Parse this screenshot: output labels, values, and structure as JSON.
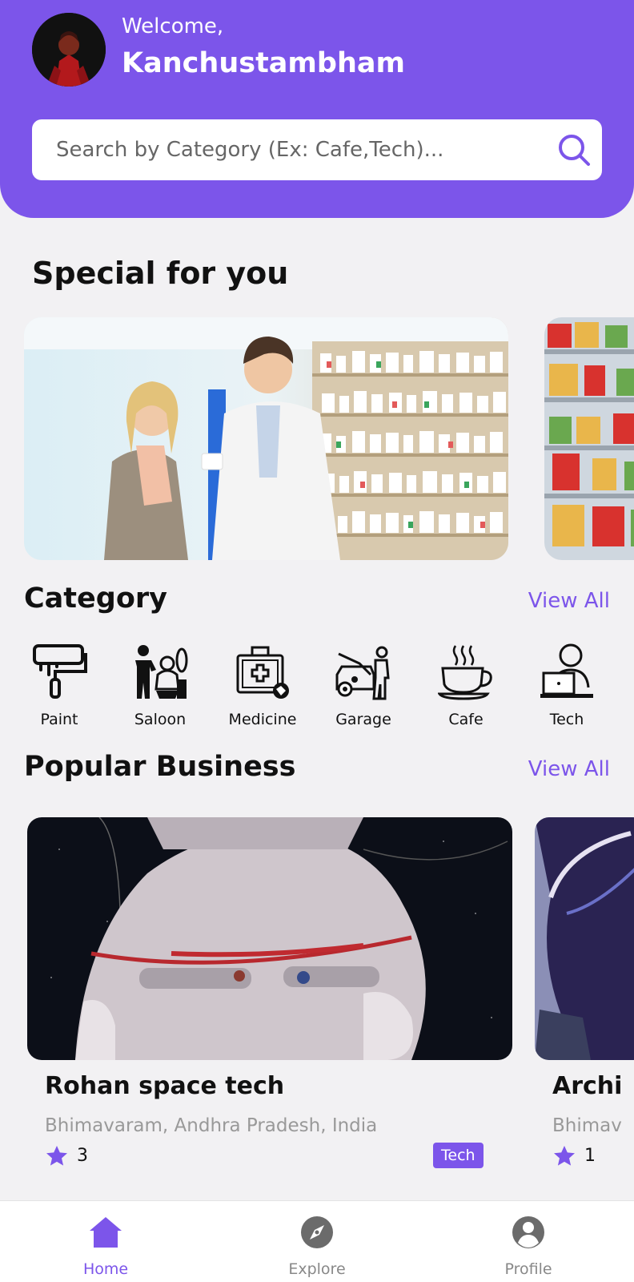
{
  "header": {
    "welcome": "Welcome,",
    "username": "Kanchustambham"
  },
  "search": {
    "placeholder": "Search by Category (Ex: Cafe,Tech)..."
  },
  "special": {
    "title": "Special for you"
  },
  "category": {
    "title": "Category",
    "view_all": "View All",
    "items": [
      {
        "label": "Paint",
        "icon": "paint-roller-icon"
      },
      {
        "label": "Saloon",
        "icon": "barber-icon"
      },
      {
        "label": "Medicine",
        "icon": "medical-kit-icon"
      },
      {
        "label": "Garage",
        "icon": "car-repair-icon"
      },
      {
        "label": "Cafe",
        "icon": "coffee-cup-icon"
      },
      {
        "label": "Tech",
        "icon": "laptop-user-icon"
      }
    ]
  },
  "popular": {
    "title": "Popular Business",
    "view_all": "View All",
    "items": [
      {
        "name": "Rohan space tech",
        "address": "Bhimavaram, Andhra Pradesh, India",
        "rating": "3",
        "tag": "Tech"
      },
      {
        "name": "Archi",
        "address": "Bhimav",
        "rating": "1"
      }
    ]
  },
  "nav": {
    "items": [
      {
        "label": "Home",
        "icon": "home-icon",
        "active": true
      },
      {
        "label": "Explore",
        "icon": "compass-icon",
        "active": false
      },
      {
        "label": "Profile",
        "icon": "user-icon",
        "active": false
      }
    ]
  },
  "colors": {
    "accent": "#7c55ea",
    "background": "#f2f1f3"
  }
}
